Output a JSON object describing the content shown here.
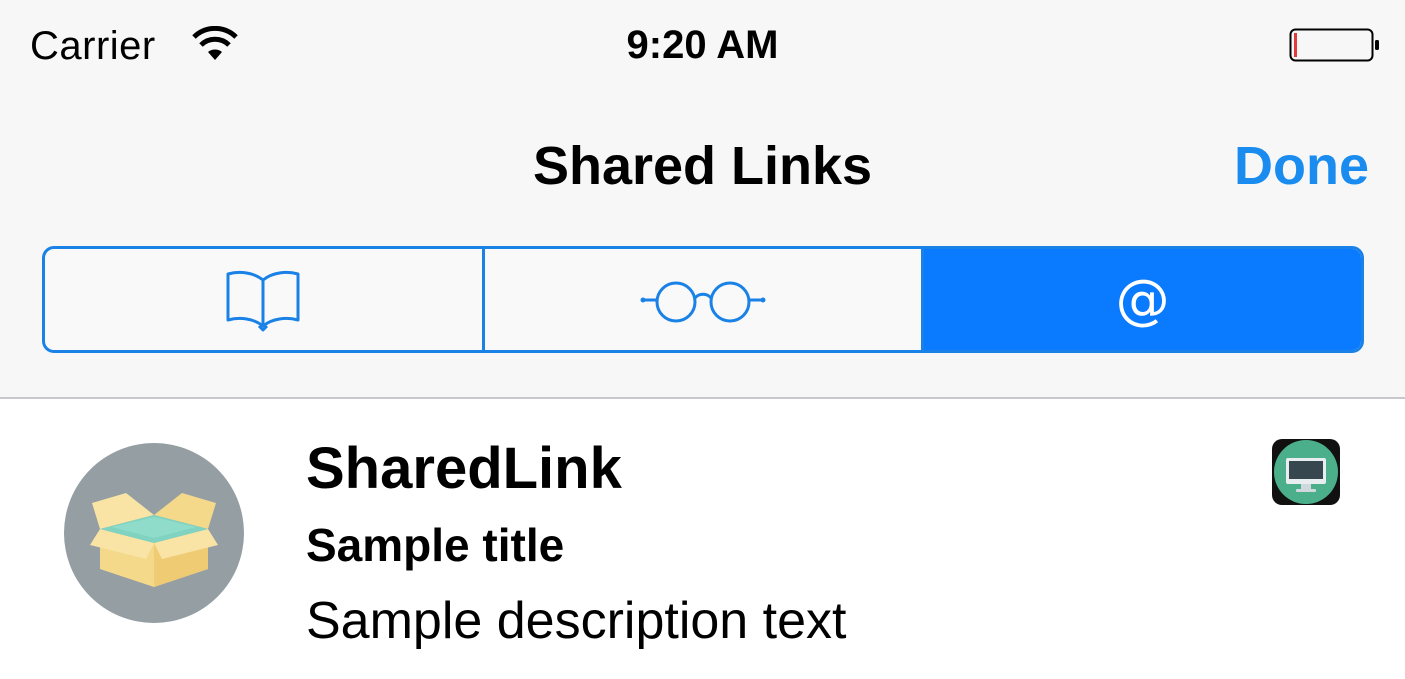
{
  "status_bar": {
    "carrier": "Carrier",
    "time": "9:20 AM",
    "wifi_icon": "wifi-icon",
    "battery_icon": "battery-icon-low"
  },
  "nav_bar": {
    "title": "Shared Links",
    "done_label": "Done"
  },
  "segments": [
    {
      "icon": "book-icon",
      "selected": false
    },
    {
      "icon": "glasses-icon",
      "selected": false
    },
    {
      "icon": "at-icon",
      "glyph": "@",
      "selected": true
    }
  ],
  "shared_links": [
    {
      "source": "SharedLink",
      "title": "Sample title",
      "description": "Sample description text",
      "avatar_icon": "open-box-icon",
      "app_icon": "monitor-icon"
    }
  ],
  "colors": {
    "accent": "#1a8cf0",
    "segment_selected": "#0a7aff",
    "battery_low": "#e23b3b",
    "avatar_bg": "#949ea3",
    "app_icon_bg": "#4caf8b"
  }
}
